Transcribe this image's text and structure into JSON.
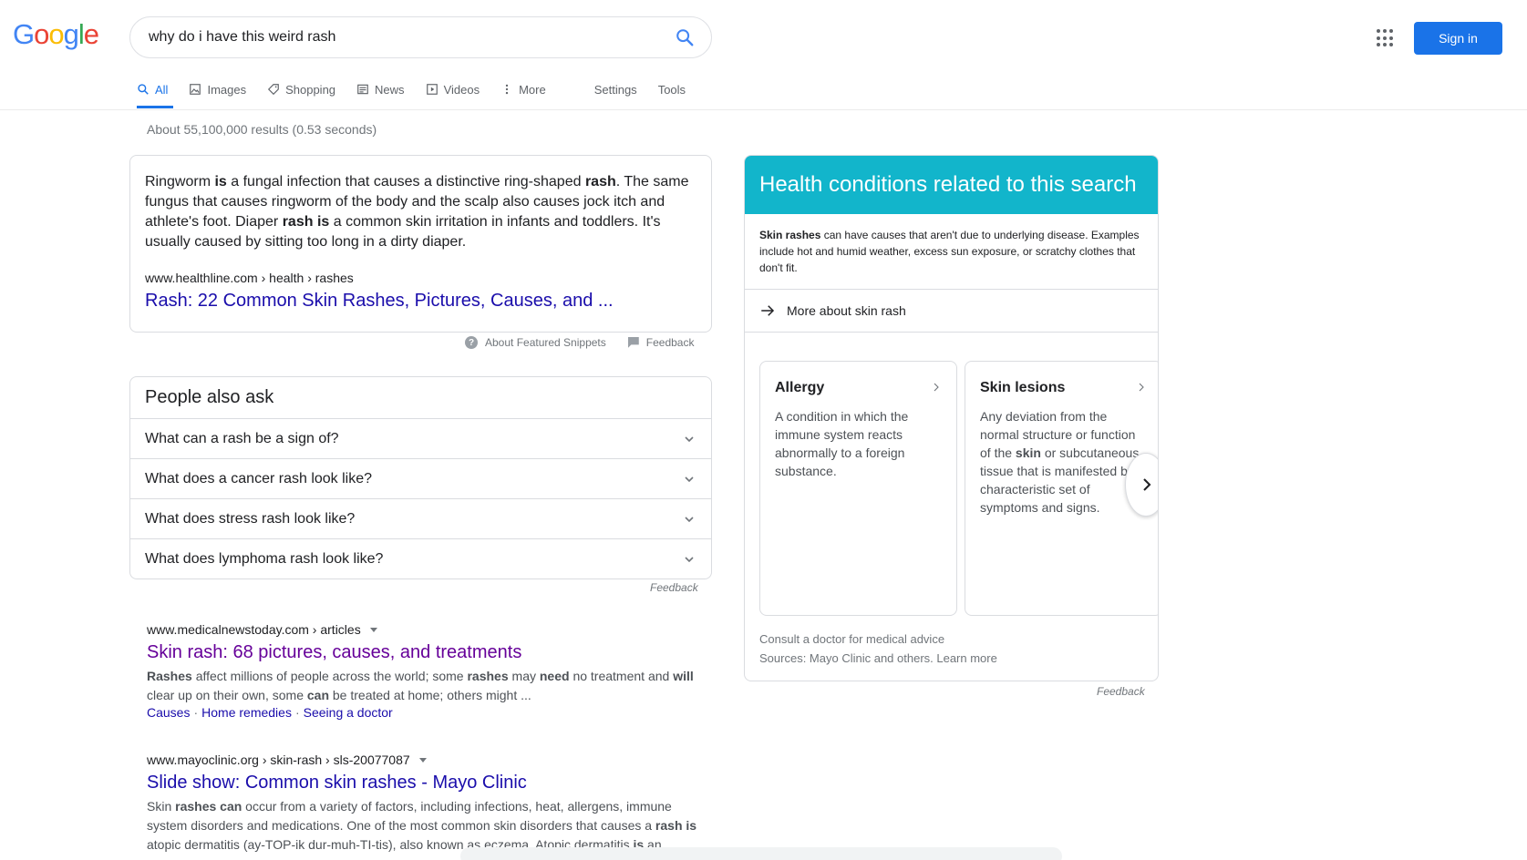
{
  "header": {
    "logo_letters": [
      {
        "ch": "G",
        "color": "#4285f4"
      },
      {
        "ch": "o",
        "color": "#ea4335"
      },
      {
        "ch": "o",
        "color": "#fbbc05"
      },
      {
        "ch": "g",
        "color": "#4285f4"
      },
      {
        "ch": "l",
        "color": "#34a853"
      },
      {
        "ch": "e",
        "color": "#ea4335"
      }
    ],
    "query": "why do i have this weird rash",
    "signin_label": "Sign in"
  },
  "tabs": {
    "all": "All",
    "images": "Images",
    "shopping": "Shopping",
    "news": "News",
    "videos": "Videos",
    "more": "More",
    "settings": "Settings",
    "tools": "Tools"
  },
  "stats": "About 55,100,000 results (0.53 seconds)",
  "snippet": {
    "cite": "www.healthline.com › health › rashes",
    "title": "Rash: 22 Common Skin Rashes, Pictures, Causes, and ...",
    "about": "About Featured Snippets",
    "feedback": "Feedback"
  },
  "paa": {
    "title": "People also ask",
    "questions": [
      "What can a rash be a sign of?",
      "What does a cancer rash look like?",
      "What does stress rash look like?",
      "What does lymphoma rash look like?"
    ],
    "feedback": "Feedback"
  },
  "results": [
    {
      "cite": "www.medicalnewstoday.com › articles",
      "title": "Skin rash: 68 pictures, causes, and treatments",
      "sitelinks": [
        "Causes",
        "Home remedies",
        "Seeing a doctor"
      ]
    },
    {
      "cite": "www.mayoclinic.org › skin-rash › sls-20077087",
      "title": "Slide show: Common skin rashes - Mayo Clinic"
    }
  ],
  "kp": {
    "title": "Health conditions related to this search",
    "more": "More about skin rash",
    "cards": [
      {
        "name": "Allergy",
        "desc": "A condition in which the immune system reacts abnormally to a foreign substance."
      },
      {
        "name": "Skin lesions"
      }
    ],
    "consult": "Consult a doctor for medical advice",
    "sources": "Sources: Mayo Clinic and others. Learn more",
    "feedback": "Feedback"
  }
}
